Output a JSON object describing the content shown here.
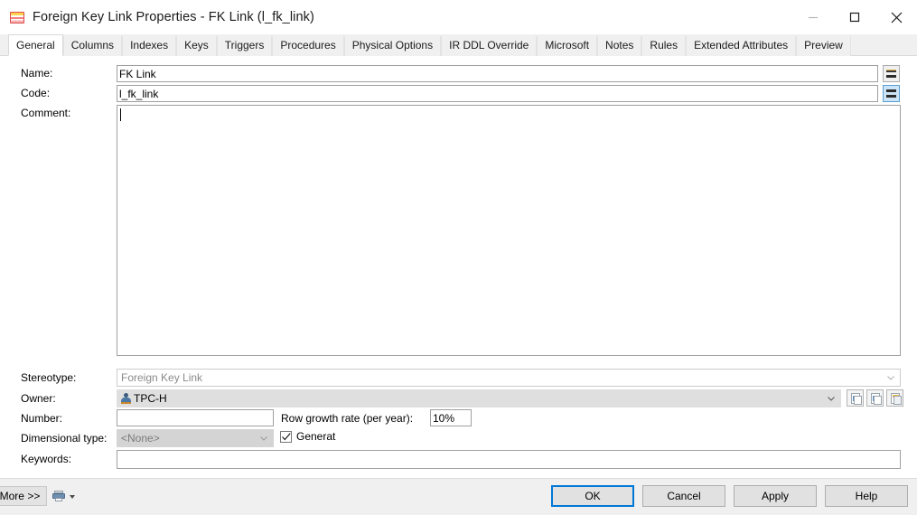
{
  "window": {
    "title": "Foreign Key Link Properties - FK Link (l_fk_link)",
    "icon": "table-icon",
    "controls": {
      "minimize": "minimize-icon",
      "maximize": "maximize-icon",
      "close": "close-icon"
    }
  },
  "tabs": [
    {
      "label": "General",
      "active": true
    },
    {
      "label": "Columns",
      "active": false
    },
    {
      "label": "Indexes",
      "active": false
    },
    {
      "label": "Keys",
      "active": false
    },
    {
      "label": "Triggers",
      "active": false
    },
    {
      "label": "Procedures",
      "active": false
    },
    {
      "label": "Physical Options",
      "active": false
    },
    {
      "label": "IR DDL Override",
      "active": false
    },
    {
      "label": "Microsoft",
      "active": false
    },
    {
      "label": "Notes",
      "active": false
    },
    {
      "label": "Rules",
      "active": false
    },
    {
      "label": "Extended Attributes",
      "active": false
    },
    {
      "label": "Preview",
      "active": false
    }
  ],
  "form": {
    "name": {
      "label": "Name:",
      "value": "FK Link",
      "placeholder": ""
    },
    "code": {
      "label": "Code:",
      "value": "l_fk_link",
      "placeholder": ""
    },
    "comment": {
      "label": "Comment:",
      "value": "",
      "placeholder": ""
    },
    "stereotype": {
      "label": "Stereotype:",
      "value": "Foreign Key Link"
    },
    "owner": {
      "label": "Owner:",
      "value": "TPC-H",
      "icon": "user-icon"
    },
    "number": {
      "label": "Number:",
      "value": "",
      "placeholder": ""
    },
    "row_growth": {
      "label": "Row growth rate (per year):",
      "value": "10%"
    },
    "dimensional_type": {
      "label": "Dimensional type:",
      "value": "<None>"
    },
    "generate": {
      "label": "Generat",
      "checked": true
    },
    "keywords": {
      "label": "Keywords:",
      "value": "",
      "placeholder": ""
    }
  },
  "field_buttons": {
    "name_equals": "=",
    "code_equals": "="
  },
  "owner_tools": [
    {
      "name": "create-object-button"
    },
    {
      "name": "object-properties-button"
    },
    {
      "name": "object-settings-button"
    }
  ],
  "footer": {
    "more": "More >>",
    "print_icon": "printer-icon",
    "buttons": [
      {
        "label": "OK",
        "primary": true
      },
      {
        "label": "Cancel",
        "primary": false
      },
      {
        "label": "Apply",
        "primary": false
      },
      {
        "label": "Help",
        "primary": false
      }
    ]
  },
  "colors": {
    "accent": "#0078d7",
    "selected_button": "#cce4f7",
    "window_bg": "#f0f0f0",
    "panel_bg": "#ffffff"
  }
}
